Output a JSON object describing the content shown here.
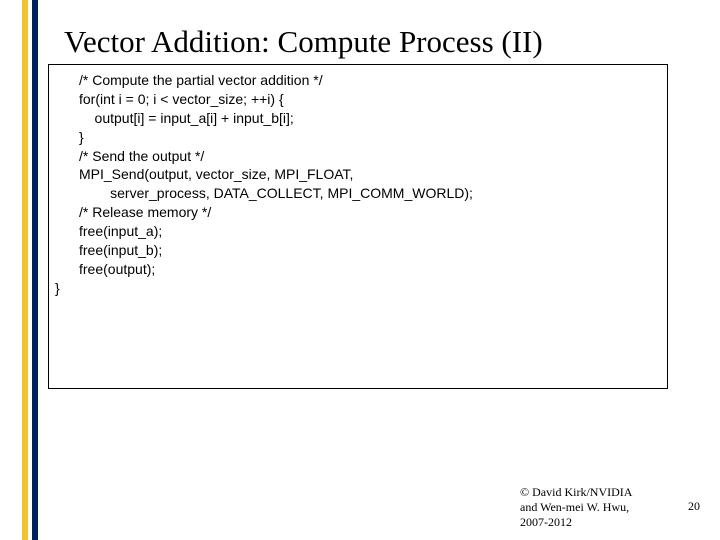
{
  "title": "Vector Addition: Compute Process (II)",
  "code": {
    "block1": "/* Compute the partial vector addition */\nfor(int i = 0; i < vector_size; ++i) {\n    output[i] = input_a[i] + input_b[i];\n}",
    "block2": "/* Send the output */\nMPI_Send(output, vector_size, MPI_FLOAT,\n        server_process, DATA_COLLECT, MPI_COMM_WORLD);",
    "block3": "/* Release memory */\nfree(input_a);\nfree(input_b);\nfree(output);",
    "close": "}"
  },
  "footer": {
    "line1": "© David Kirk/NVIDIA",
    "line2": "and Wen-mei W. Hwu,",
    "line3": "2007-2012"
  },
  "page_number": "20"
}
